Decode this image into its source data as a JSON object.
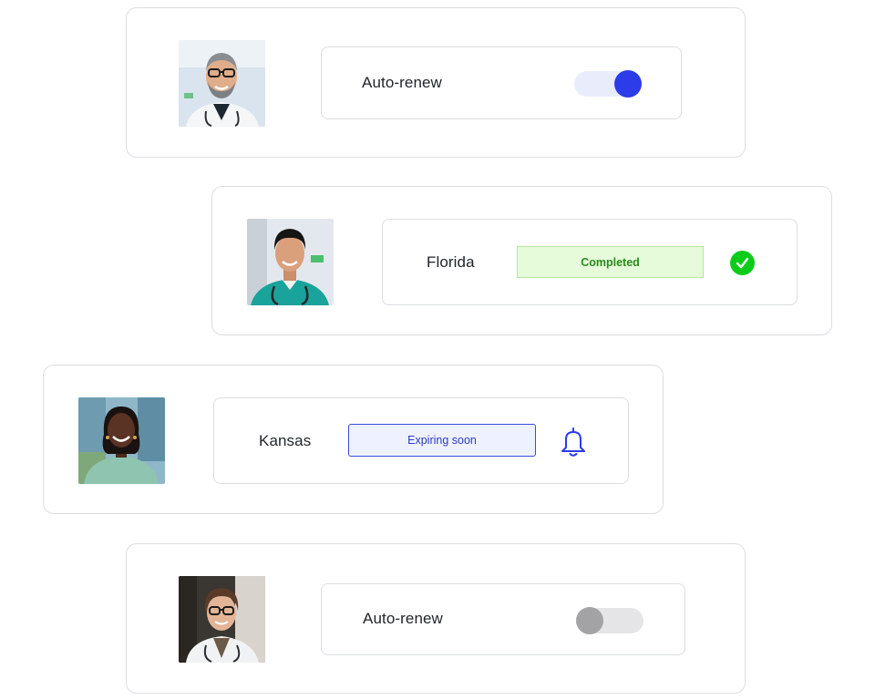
{
  "cards": [
    {
      "avatar": "avatar-bearded-doctor-glasses",
      "control": "toggle",
      "label": "Auto-renew",
      "toggle_state": "on"
    },
    {
      "avatar": "avatar-doctor-scrubs",
      "control": "status",
      "label": "Florida",
      "status": "Completed",
      "status_icon": "check-circle-icon"
    },
    {
      "avatar": "avatar-woman-smiling",
      "control": "status",
      "label": "Kansas",
      "status": "Expiring soon",
      "status_icon": "bell-icon"
    },
    {
      "avatar": "avatar-doctor-woman-glasses",
      "control": "toggle",
      "label": "Auto-renew",
      "toggle_state": "off"
    }
  ],
  "colors": {
    "toggle_on_knob": "#2c3ce8",
    "toggle_on_track": "#e9edfb",
    "toggle_off_knob": "#a3a3a6",
    "toggle_off_track": "#e5e5e7",
    "completed_bg": "#e6fbd9",
    "completed_text": "#2a8a1f",
    "check_green": "#0ccc1a",
    "expiring_border": "#3b4bd8",
    "expiring_bg": "#eef1ff",
    "card_border": "#dcdde1"
  }
}
